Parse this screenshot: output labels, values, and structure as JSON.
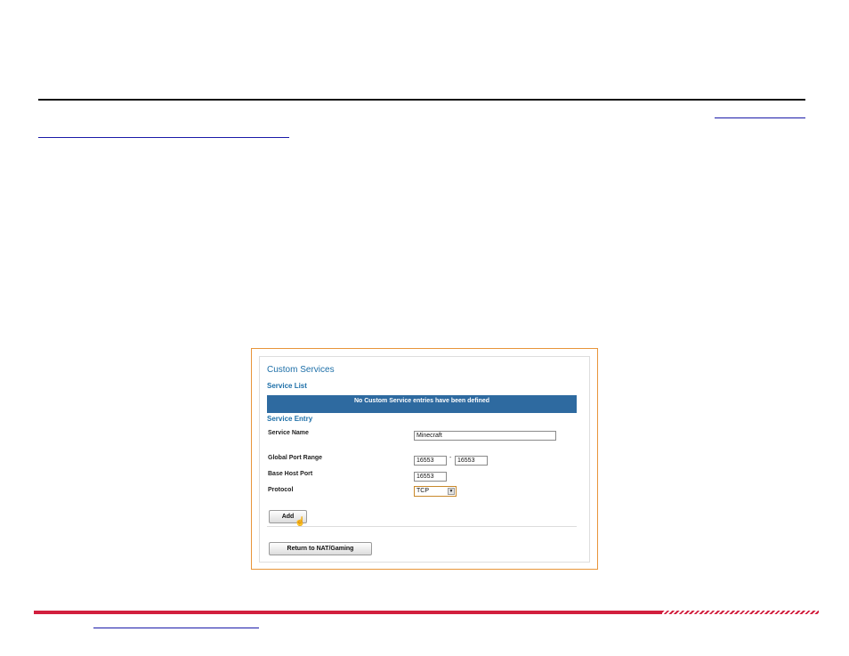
{
  "custom_services": {
    "title": "Custom Services",
    "service_list_heading": "Service List",
    "empty_message": "No Custom Service entries have been defined",
    "service_entry_heading": "Service Entry",
    "fields": {
      "service_name_label": "Service Name",
      "service_name_value": "Minecraft",
      "global_port_range_label": "Global Port Range",
      "global_port_start": "16553",
      "global_port_separator": "-",
      "global_port_end": "16553",
      "base_host_port_label": "Base Host Port",
      "base_host_port_value": "16553",
      "protocol_label": "Protocol",
      "protocol_value": "TCP",
      "protocol_arrow": "▼"
    },
    "add_button_label": "Add",
    "return_button_label": "Return to NAT/Gaming"
  },
  "colors": {
    "accent_blue": "#1d6fa8",
    "header_bar": "#2e6aa0",
    "frame_border": "#e8953a",
    "footer_red": "#d21f3e"
  }
}
